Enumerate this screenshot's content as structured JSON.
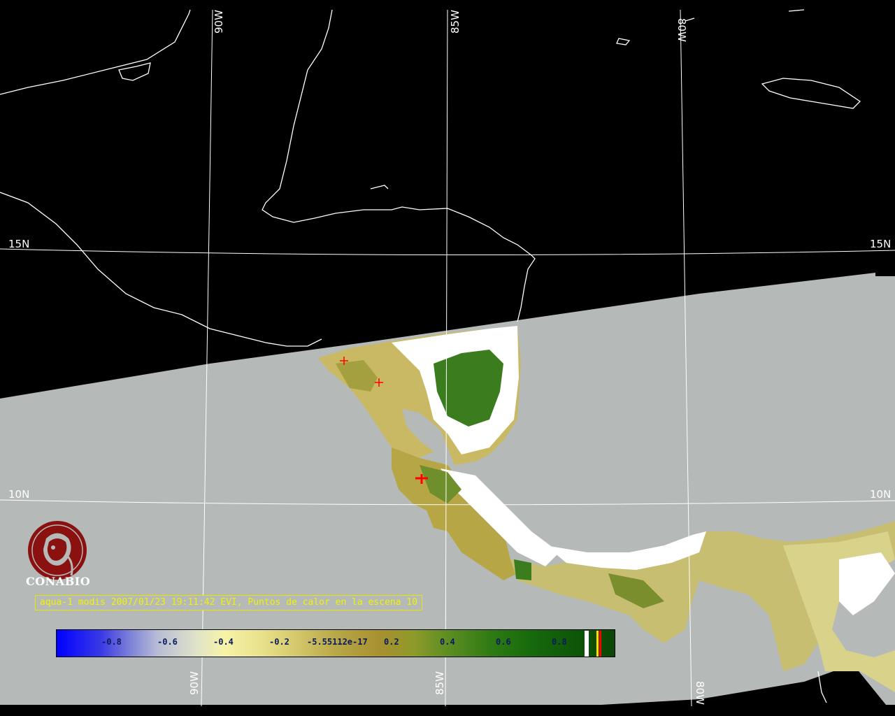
{
  "map": {
    "longitude_labels_top": [
      "90W",
      "85W",
      "80W"
    ],
    "longitude_labels_bottom": [
      "90W",
      "85W",
      "80W"
    ],
    "latitude_labels_left": [
      "15N",
      "10N"
    ],
    "latitude_labels_right": [
      "15N",
      "10N"
    ],
    "colors": {
      "background": "#000000",
      "no_data_swath": "#b5bab9",
      "coastline": "#ffffff",
      "graticule": "#ffffff",
      "cloud": "#ffffff",
      "hotspot": "#ff0000"
    }
  },
  "logo": {
    "name": "CONABIO"
  },
  "caption": {
    "text": "aqua-1 modis 2007/01/23 19:11:42 EVI, Puntos de calor en la escena 10"
  },
  "scale": {
    "ticks": [
      "-0.8",
      "-0.6",
      "-0.4",
      "-0.2",
      "-5.55112e-17",
      "0.2",
      "0.4",
      "0.6",
      "0.8"
    ],
    "colors": {
      "low": "#0000ff",
      "mid": "#f7f3a8",
      "high": "#0b4606"
    }
  }
}
